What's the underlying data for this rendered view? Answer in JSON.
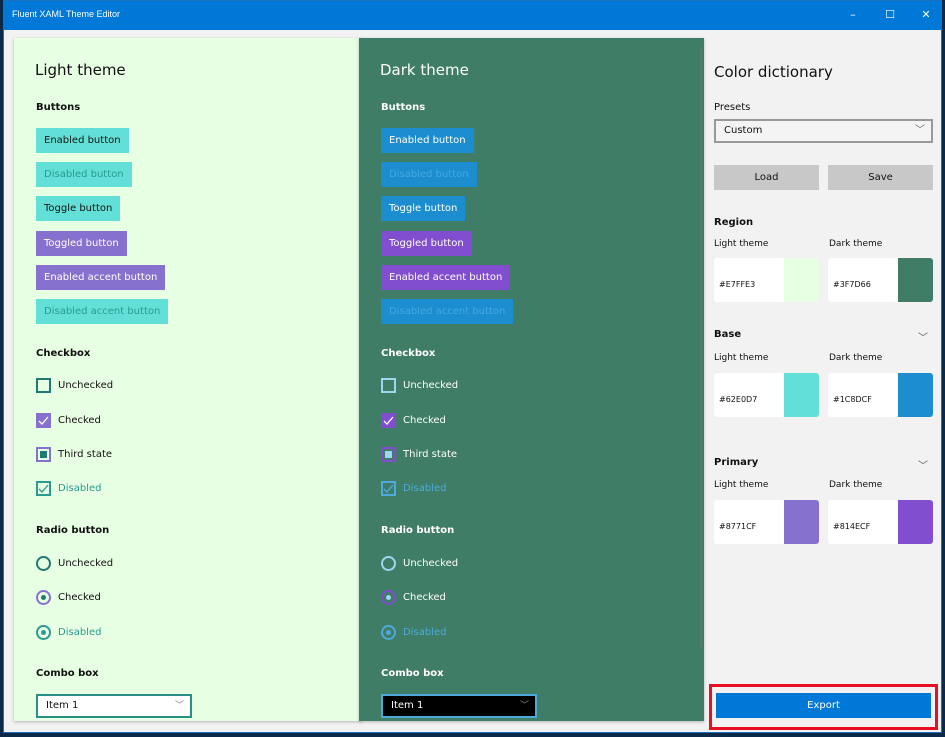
{
  "window": {
    "title": "Fluent XAML Theme Editor",
    "controls": {
      "minimize": "–",
      "maximize": "☐",
      "close": "✕"
    }
  },
  "light_theme": {
    "title": "Light theme",
    "buttons_header": "Buttons",
    "buttons": [
      {
        "label": "Enabled button",
        "state": "enabled",
        "style": "base"
      },
      {
        "label": "Disabled button",
        "state": "disabled",
        "style": "base"
      },
      {
        "label": "Toggle button",
        "state": "enabled",
        "style": "base"
      },
      {
        "label": "Toggled button",
        "state": "toggled",
        "style": "primary"
      },
      {
        "label": "Enabled accent button",
        "state": "enabled",
        "style": "primary"
      },
      {
        "label": "Disabled accent button",
        "state": "disabled",
        "style": "base"
      }
    ],
    "checkbox_header": "Checkbox",
    "checkboxes": [
      {
        "label": "Unchecked",
        "state": "unchecked"
      },
      {
        "label": "Checked",
        "state": "checked"
      },
      {
        "label": "Third state",
        "state": "indeterminate"
      },
      {
        "label": "Disabled",
        "state": "disabled-checked"
      }
    ],
    "radio_header": "Radio button",
    "radios": [
      {
        "label": "Unchecked",
        "state": "unchecked"
      },
      {
        "label": "Checked",
        "state": "checked"
      },
      {
        "label": "Disabled",
        "state": "disabled-checked"
      }
    ],
    "combo_header": "Combo box",
    "combo_value": "Item 1"
  },
  "dark_theme": {
    "title": "Dark theme",
    "buttons_header": "Buttons",
    "buttons": [
      {
        "label": "Enabled button",
        "state": "enabled",
        "style": "base"
      },
      {
        "label": "Disabled button",
        "state": "disabled",
        "style": "base"
      },
      {
        "label": "Toggle button",
        "state": "enabled",
        "style": "base"
      },
      {
        "label": "Toggled button",
        "state": "toggled",
        "style": "primary"
      },
      {
        "label": "Enabled accent button",
        "state": "enabled",
        "style": "primary"
      },
      {
        "label": "Disabled accent button",
        "state": "disabled",
        "style": "base"
      }
    ],
    "checkbox_header": "Checkbox",
    "checkboxes": [
      {
        "label": "Unchecked",
        "state": "unchecked"
      },
      {
        "label": "Checked",
        "state": "checked"
      },
      {
        "label": "Third state",
        "state": "indeterminate"
      },
      {
        "label": "Disabled",
        "state": "disabled-checked"
      }
    ],
    "radio_header": "Radio button",
    "radios": [
      {
        "label": "Unchecked",
        "state": "unchecked"
      },
      {
        "label": "Checked",
        "state": "checked"
      },
      {
        "label": "Disabled",
        "state": "disabled-checked"
      }
    ],
    "combo_header": "Combo box",
    "combo_value": "Item 1"
  },
  "color_dictionary": {
    "title": "Color dictionary",
    "presets_label": "Presets",
    "presets_value": "Custom",
    "load_label": "Load",
    "save_label": "Save",
    "groups": [
      {
        "name": "Region",
        "light_label": "Light theme",
        "dark_label": "Dark theme",
        "light_hex": "#E7FFE3",
        "dark_hex": "#3F7D66",
        "collapsible": false
      },
      {
        "name": "Base",
        "light_label": "Light theme",
        "dark_label": "Dark theme",
        "light_hex": "#62E0D7",
        "dark_hex": "#1C8DCF",
        "collapsible": true
      },
      {
        "name": "Primary",
        "light_label": "Light theme",
        "dark_label": "Dark theme",
        "light_hex": "#8771CF",
        "dark_hex": "#814ECF",
        "collapsible": true
      }
    ],
    "export_label": "Export"
  },
  "colors": {
    "titlebar": "#0078D7",
    "highlight_border": "#E81123"
  }
}
